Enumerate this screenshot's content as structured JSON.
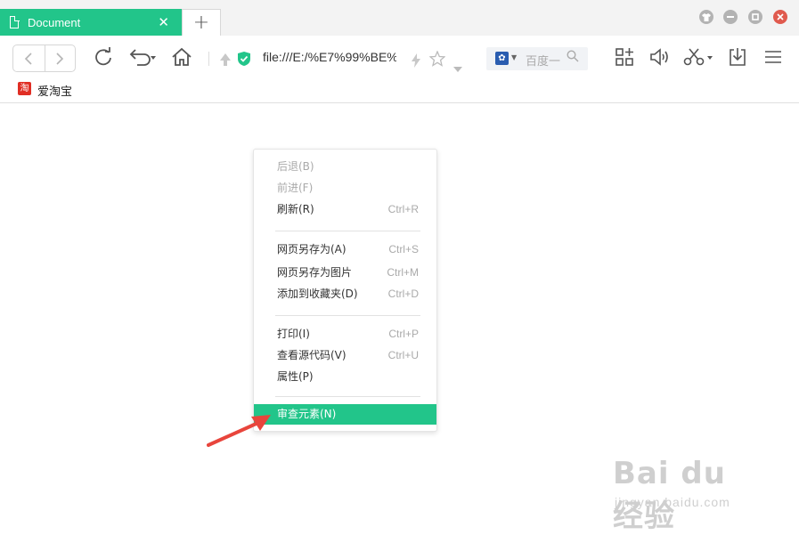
{
  "tab": {
    "title": "Document",
    "close_glyph": "✕",
    "new_tab_glyph": "+"
  },
  "window_controls": [
    "shirt-icon",
    "minimize-icon",
    "maximize-icon",
    "close-icon"
  ],
  "toolbar": {
    "url": "file:///E:/%E7%99%BE%",
    "search_placeholder": "百度一",
    "icons": [
      "back-icon",
      "forward-icon",
      "refresh-icon",
      "undo-icon",
      "home-icon",
      "lightning-icon",
      "star-icon",
      "extensions-icon",
      "speaker-icon",
      "scissors-icon",
      "download-icon",
      "menu-icon"
    ]
  },
  "bookmarks": [
    {
      "icon_text": "淘",
      "label": "爱淘宝"
    }
  ],
  "context_menu": {
    "items": [
      {
        "label": "后退(B)",
        "shortcut": "",
        "disabled": true
      },
      {
        "label": "前进(F)",
        "shortcut": "",
        "disabled": true
      },
      {
        "label": "刷新(R)",
        "shortcut": "Ctrl+R",
        "disabled": false
      },
      {
        "label": "网页另存为(A)",
        "shortcut": "Ctrl+S",
        "disabled": false
      },
      {
        "label": "网页另存为图片",
        "shortcut": "Ctrl+M",
        "disabled": false
      },
      {
        "label": "添加到收藏夹(D)",
        "shortcut": "Ctrl+D",
        "disabled": false
      },
      {
        "label": "打印(I)",
        "shortcut": "Ctrl+P",
        "disabled": false
      },
      {
        "label": "查看源代码(V)",
        "shortcut": "Ctrl+U",
        "disabled": false
      },
      {
        "label": "属性(P)",
        "shortcut": "",
        "disabled": false
      },
      {
        "label": "审查元素(N)",
        "shortcut": "",
        "disabled": false,
        "highlighted": true
      }
    ]
  },
  "watermark": {
    "main": "Bai du 经验",
    "sub": "jingyan.baidu.com"
  },
  "colors": {
    "accent": "#22c58a",
    "arrow": "#e8453c"
  }
}
